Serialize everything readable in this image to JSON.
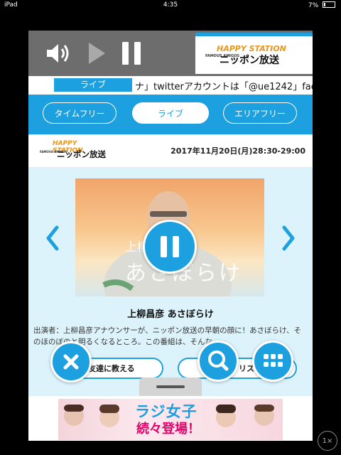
{
  "status": {
    "device": "iPad",
    "time": "4:35",
    "battery": "7%"
  },
  "player": {
    "logo_top": "HAPPY STATION",
    "logo_bottom": "ニッポン放送",
    "logo_small": "FAMOUS AMIGOS"
  },
  "ticker": {
    "label": "ライブ",
    "text": "ナ」twitterアカウントは「@ue1242」facebo"
  },
  "tabs": [
    {
      "label": "タイムフリー"
    },
    {
      "label": "ライブ"
    },
    {
      "label": "エリアフリー"
    }
  ],
  "program": {
    "date": "2017年11月20日(月)28:30-29:00",
    "image_caption_top": "上柳昌",
    "image_caption": "あさぼらけ",
    "title": "上柳昌彦 あさぼらけ",
    "description": "出演者：上柳昌彦アナウンサーが、ニッポン放送の早朝の顔に！あさぼらけ、そのほのぼのと明るくなるところ。この番組は、そんな…",
    "friend_button": "友達に教える",
    "list_button": "リスト追加"
  },
  "ad": {
    "line1": "ラジ女子",
    "line2": "続々登場！"
  },
  "zoom": "1×",
  "colors": {
    "accent": "#1da0e0",
    "player_bg": "#6d6d6d",
    "content_bg": "#ddf3fb"
  }
}
